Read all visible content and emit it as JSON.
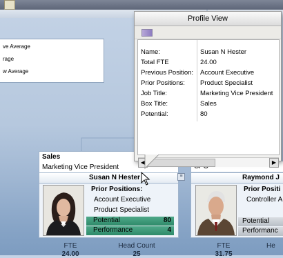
{
  "legend": {
    "rows": [
      "ve Average",
      "rage",
      "w Average"
    ]
  },
  "profile": {
    "title": "Profile View",
    "fields": [
      {
        "label": "Name:",
        "value": "Susan N Hester"
      },
      {
        "label": "Total FTE",
        "value": "24.00"
      },
      {
        "label": "Previous Position:",
        "value": "Account Executive"
      },
      {
        "label": "Prior Positions:",
        "value": "Product Specialist"
      },
      {
        "label": "Job Title:",
        "value": "Marketing Vice President"
      },
      {
        "label": "Box Title:",
        "value": "Sales"
      },
      {
        "label": "Potential:",
        "value": "80"
      }
    ],
    "scroll_left": "◀",
    "scroll_right": "▶"
  },
  "card_left": {
    "department": "Sales",
    "job_title": "Marketing Vice President",
    "name": "Susan N Hester",
    "prior_positions_title": "Prior Positions:",
    "prior_positions": [
      "Account Executive",
      "Product Specialist"
    ],
    "potential_label": "Potential",
    "potential_value": "80",
    "performance_label": "Performance",
    "performance_value": "4",
    "fte_label": "FTE",
    "fte_value": "24.00",
    "headcount_label": "Head Count",
    "headcount_value": "25"
  },
  "card_right": {
    "job_title": "CFO",
    "name": "Raymond J",
    "prior_positions_title": "Prior Positi",
    "prior_positions": [
      "Controller A"
    ],
    "potential_label": "Potential",
    "performance_label": "Performanc",
    "fte_label": "FTE",
    "fte_value": "31.75",
    "headcount_label": "He"
  },
  "colors": {
    "accent_green": "#2e8a69",
    "background_blue": "#9fb6d2"
  },
  "icons": [
    "app-icon",
    "toolbar-icon",
    "expand-icon",
    "mouse-cursor-icon"
  ]
}
